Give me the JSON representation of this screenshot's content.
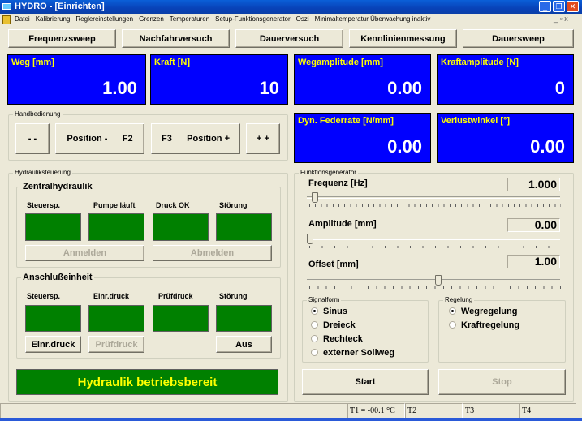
{
  "window": {
    "title": "HYDRO - [Einrichten]"
  },
  "menu": [
    "Datei",
    "Kalibrierung",
    "Reglereinstellungen",
    "Grenzen",
    "Temperaturen",
    "Setup-Funktionsgenerator",
    "Oszi",
    "Minimaltemperatur Überwachung inaktiv"
  ],
  "modes": [
    "Frequenzsweep",
    "Nachfahrversuch",
    "Dauerversuch",
    "Kennlinienmessung",
    "Dauersweep"
  ],
  "displays": [
    {
      "label": "Weg [mm]",
      "value": "1.00"
    },
    {
      "label": "Kraft [N]",
      "value": "10"
    },
    {
      "label": "Wegamplitude [mm]",
      "value": "0.00"
    },
    {
      "label": "Kraftamplitude [N]",
      "value": "0"
    },
    {
      "label": "Dyn. Federrate [N/mm]",
      "value": "0.00"
    },
    {
      "label": "Verlustwinkel  [°]",
      "value": "0.00"
    }
  ],
  "colors": {
    "display_bg": "#0000ff",
    "display_label": "#ffff00",
    "status_ok": "#008000"
  },
  "hand": {
    "title": "Handbedienung",
    "buttons": [
      "- -",
      "Position -      F2",
      "F3      Position +",
      "+ +"
    ]
  },
  "hydraulik": {
    "title": "Hydrauliksteuerung",
    "zentral": {
      "title": "Zentralhydraulik",
      "labels": [
        "Steuersp.",
        "Pumpe läuft",
        "Druck OK",
        "Störung"
      ],
      "anmelden": "Anmelden",
      "abmelden": "Abmelden"
    },
    "anschluss": {
      "title": "Anschlußeinheit",
      "labels": [
        "Steuersp.",
        "Einr.druck",
        "Prüfdruck",
        "Störung"
      ],
      "einr": "Einr.druck",
      "pruef": "Prüfdruck",
      "aus": "Aus"
    },
    "status": "Hydraulik betriebsbereit"
  },
  "fg": {
    "title": "Funktionsgenerator",
    "frequenz": {
      "label": "Frequenz  [Hz]",
      "value": "1.000",
      "slider": 0.02
    },
    "amplitude": {
      "label": "Amplitude  [mm]",
      "value": "0.00",
      "slider": 0.0
    },
    "offset": {
      "label": "Offset  [mm]",
      "value": "1.00",
      "slider": 0.52
    },
    "signalform": {
      "title": "Signalform",
      "options": [
        "Sinus",
        "Dreieck",
        "Rechteck",
        "externer Sollweg"
      ],
      "selected": 0
    },
    "regelung": {
      "title": "Regelung",
      "options": [
        "Wegregelung",
        "Kraftregelung"
      ],
      "selected": 0
    },
    "start": "Start",
    "stop": "Stop"
  },
  "statusbar": [
    "",
    "T1 = -00.1 °C",
    "T2",
    "T3",
    "T4"
  ]
}
